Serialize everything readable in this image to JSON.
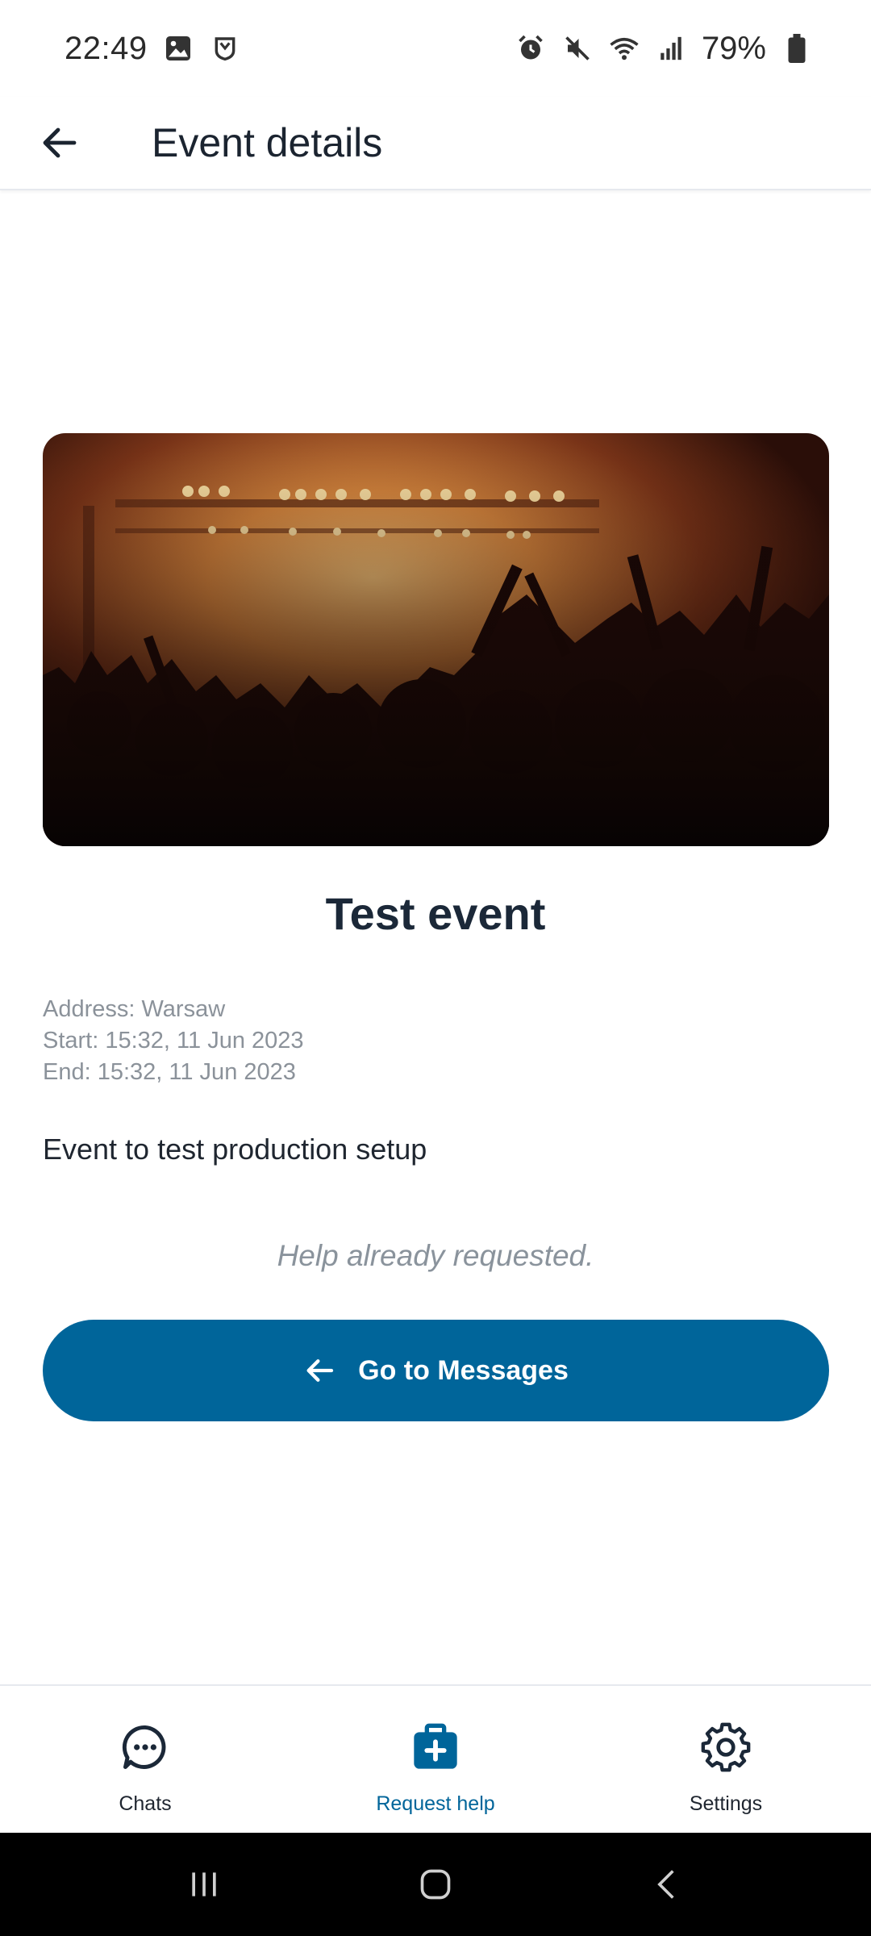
{
  "status_bar": {
    "time": "22:49",
    "battery_percent": "79%",
    "icons_left": [
      "gallery-icon",
      "shield-app-icon"
    ],
    "icons_right": [
      "alarm-icon",
      "mute-icon",
      "wifi-icon",
      "signal-icon",
      "battery-icon"
    ]
  },
  "app_bar": {
    "title": "Event details",
    "back_icon": "arrow-back-icon"
  },
  "event": {
    "image_alt": "concert-crowd-photo",
    "title": "Test event",
    "address": "Address: Warsaw",
    "start": "Start: 15:32, 11 Jun 2023",
    "end": "End: 15:32, 11 Jun 2023",
    "description": "Event to test production setup",
    "help_status": "Help already requested."
  },
  "actions": {
    "go_to_messages_label": "Go to Messages",
    "go_to_messages_icon": "arrow-left-icon"
  },
  "bottom_nav": {
    "items": [
      {
        "label": "Chats",
        "icon": "chat-bubble-icon",
        "active": false
      },
      {
        "label": "Request help",
        "icon": "medical-bag-icon",
        "active": true
      },
      {
        "label": "Settings",
        "icon": "gear-icon",
        "active": false
      }
    ]
  },
  "colors": {
    "primary": "#00659a",
    "text_dark": "#1b2838",
    "text_muted": "#8b929a"
  }
}
